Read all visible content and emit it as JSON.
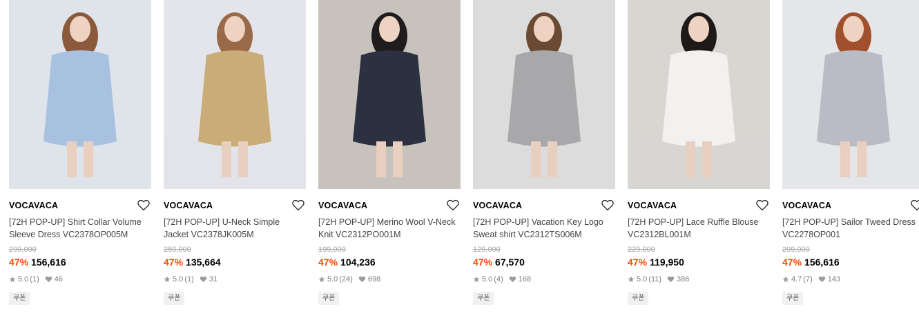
{
  "products": [
    {
      "brand": "VOCAVACA",
      "name": "[72H POP-UP] Shirt Collar Volume Sleeve Dress VC2378OP005M",
      "original_price": "299,000",
      "discount": "47%",
      "price": "156,616",
      "rating": "5.0",
      "reviews": "(1)",
      "likes": "46",
      "badge": "쿠폰",
      "image": "photo-1",
      "colors": {
        "bg": "#dfe3ea",
        "garment": "#a9c1e0",
        "hair": "#8b5a3c"
      }
    },
    {
      "brand": "VOCAVACA",
      "name": "[72H POP-UP] U-Neck Simple Jacket VC2378JK005M",
      "original_price": "259,000",
      "discount": "47%",
      "price": "135,664",
      "rating": "5.0",
      "reviews": "(1)",
      "likes": "31",
      "badge": "쿠폰",
      "image": "photo-2",
      "colors": {
        "bg": "#e3e5ea",
        "garment": "#c9ac78",
        "hair": "#9a6a48"
      }
    },
    {
      "brand": "VOCAVACA",
      "name": "[72H POP-UP] Merino Wool V-Neck Knit VC2312PO001M",
      "original_price": "199,000",
      "discount": "47%",
      "price": "104,236",
      "rating": "5.0",
      "reviews": "(24)",
      "likes": "698",
      "badge": "쿠폰",
      "image": "photo-3",
      "colors": {
        "bg": "#c8c2bc",
        "garment": "#2b3140",
        "hair": "#1e1c1c"
      }
    },
    {
      "brand": "VOCAVACA",
      "name": "[72H POP-UP] Vacation Key Logo Sweat shirt VC2312TS006M",
      "original_price": "129,000",
      "discount": "47%",
      "price": "67,570",
      "rating": "5.0",
      "reviews": "(4)",
      "likes": "168",
      "badge": "쿠폰",
      "image": "photo-4",
      "colors": {
        "bg": "#dcdcdc",
        "garment": "#a8a8aa",
        "hair": "#6b4a34"
      }
    },
    {
      "brand": "VOCAVACA",
      "name": "[72H POP-UP] Lace Ruffle Blouse VC2312BL001M",
      "original_price": "229,000",
      "discount": "47%",
      "price": "119,950",
      "rating": "5.0",
      "reviews": "(11)",
      "likes": "386",
      "badge": "쿠폰",
      "image": "photo-5",
      "colors": {
        "bg": "#d9d6d2",
        "garment": "#f3f1ef",
        "hair": "#1f1a1a"
      }
    },
    {
      "brand": "VOCAVACA",
      "name": "[72H POP-UP] Sailor Tweed Dress VC2278OP001",
      "original_price": "299,000",
      "discount": "47%",
      "price": "156,616",
      "rating": "4.7",
      "reviews": "(7)",
      "likes": "143",
      "badge": "쿠폰",
      "image": "photo-6",
      "colors": {
        "bg": "#e4e6ea",
        "garment": "#b9bcc4",
        "hair": "#a1502e"
      }
    }
  ]
}
